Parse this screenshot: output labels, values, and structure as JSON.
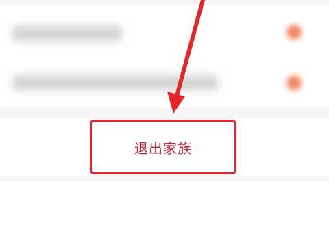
{
  "family_panel": {
    "exit_button_label": "退出家族"
  },
  "colors": {
    "annotation_red": "#e52626",
    "label_red": "#c8243a",
    "blurred_badge": "#ef7d55"
  }
}
